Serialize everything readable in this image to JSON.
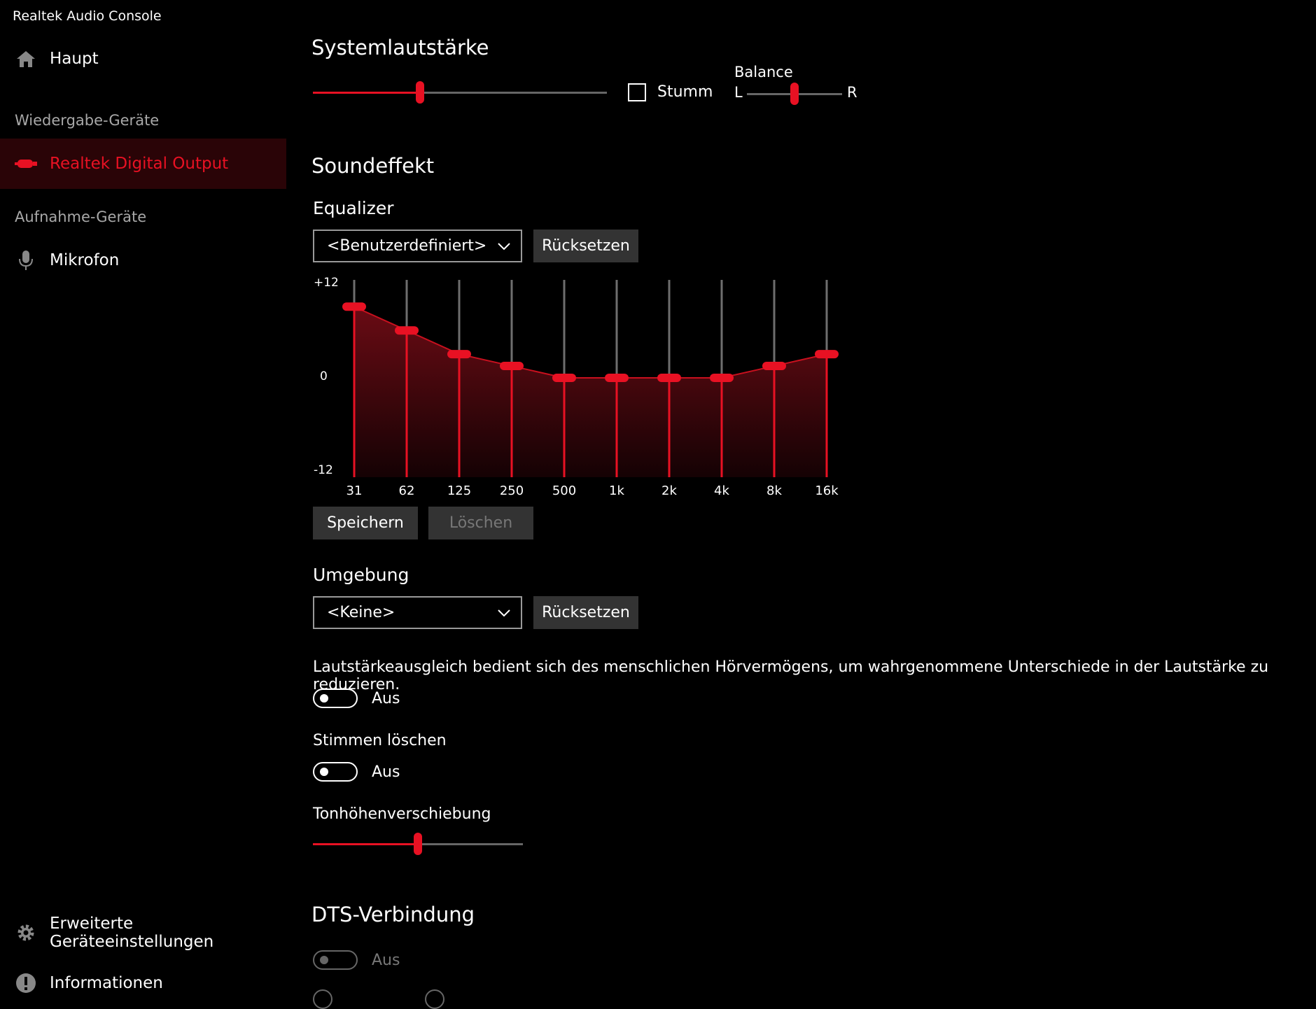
{
  "app": {
    "title": "Realtek Audio Console"
  },
  "sidebar": {
    "home_label": "Haupt",
    "playback_section": "Wiedergabe-Geräte",
    "playback_device": "Realtek Digital Output",
    "recording_section": "Aufnahme-Geräte",
    "recording_device": "Mikrofon",
    "advanced_label": "Erweiterte Geräteeinstellungen",
    "info_label": "Informationen"
  },
  "system_volume": {
    "title": "Systemlautstärke",
    "level": 0.365,
    "mute_label": "Stumm",
    "muted": false,
    "balance_label": "Balance",
    "balance_left": "L",
    "balance_right": "R",
    "balance_level": 0.5
  },
  "sound_effect": {
    "title": "Soundeffekt",
    "equalizer": {
      "label": "Equalizer",
      "preset": "<Benutzerdefiniert>",
      "reset_label": "Rücksetzen",
      "y_max_label": "+12",
      "y_mid_label": "0",
      "y_min_label": "-12",
      "bands": [
        {
          "freq": "31",
          "gain": 9
        },
        {
          "freq": "62",
          "gain": 6
        },
        {
          "freq": "125",
          "gain": 3
        },
        {
          "freq": "250",
          "gain": 1.5
        },
        {
          "freq": "500",
          "gain": 0
        },
        {
          "freq": "1k",
          "gain": 0
        },
        {
          "freq": "2k",
          "gain": 0
        },
        {
          "freq": "4k",
          "gain": 0
        },
        {
          "freq": "8k",
          "gain": 1.5
        },
        {
          "freq": "16k",
          "gain": 3
        }
      ],
      "save_label": "Speichern",
      "delete_label": "Löschen"
    },
    "environment": {
      "label": "Umgebung",
      "preset": "<Keine>",
      "reset_label": "Rücksetzen"
    },
    "loudness": {
      "description": "Lautstärkeausgleich bedient sich des menschlichen Hörvermögens, um wahrgenommene Unterschiede in der Lautstärke zu reduzieren.",
      "state": "Aus"
    },
    "voice_cancel": {
      "label": "Stimmen löschen",
      "state": "Aus"
    },
    "pitch_shift": {
      "label": "Tonhöhenverschiebung",
      "level": 0.5
    }
  },
  "dts": {
    "title": "DTS-Verbindung",
    "state": "Aus"
  },
  "colors": {
    "accent": "#e81123",
    "selected_bg": "#2a0407",
    "background": "#000000"
  }
}
